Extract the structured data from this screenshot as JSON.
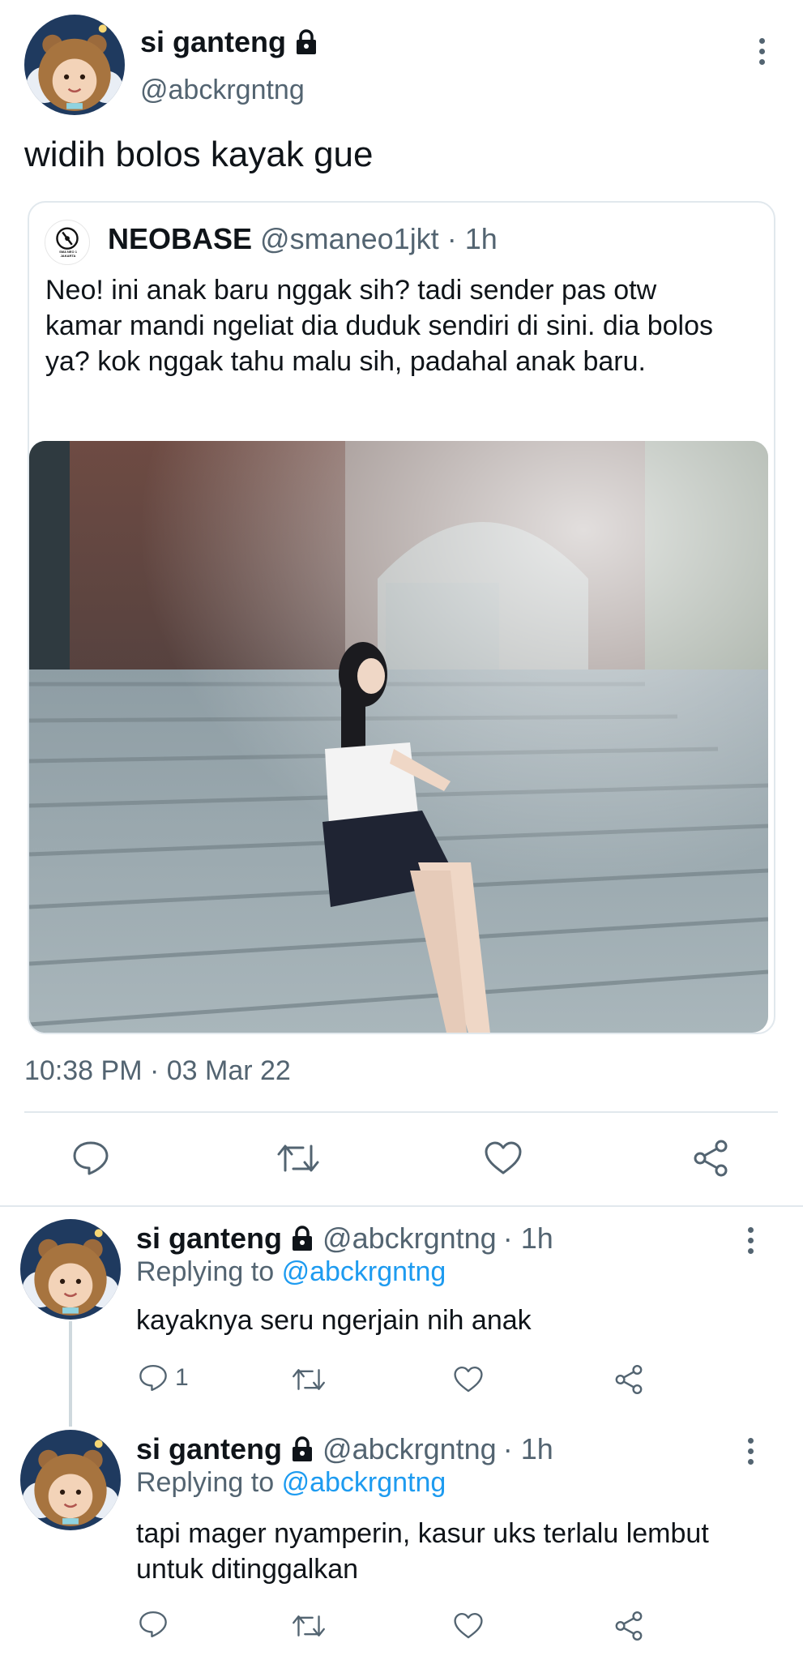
{
  "main_tweet": {
    "display_name": "si ganteng",
    "handle": "@abckrgntng",
    "text": "widih bolos kayak gue",
    "timestamp": "10:38 PM · 03 Mar 22"
  },
  "quoted_tweet": {
    "display_name": "NEOBASE",
    "handle": "@smaneo1jkt",
    "time": "· 1h",
    "avatar_text_1": "SMA NEO 1",
    "avatar_text_2": "JAKARTA",
    "text": "Neo! ini anak baru nggak sih? tadi sender pas otw kamar mandi ngeliat dia duduk sendiri di sini. dia bolos ya? kok nggak tahu malu sih, padahal anak baru."
  },
  "replies": [
    {
      "display_name": "si ganteng",
      "handle": "@abckrgntng",
      "time": "· 1h",
      "replying_prefix": "Replying to",
      "replying_to": "@abckrgntng",
      "text": "kayaknya seru ngerjain nih anak",
      "reply_count": "1"
    },
    {
      "display_name": "si ganteng",
      "handle": "@abckrgntng",
      "time": "· 1h",
      "replying_prefix": "Replying to",
      "replying_to": "@abckrgntng",
      "text": "tapi mager nyamperin, kasur uks terlalu lembut untuk ditinggalkan",
      "reply_count": ""
    }
  ],
  "icons": {
    "reply": "speech-bubble-icon",
    "retweet": "retweet-icon",
    "like": "heart-icon",
    "share": "share-icon",
    "lock": "lock-icon",
    "more": "three-dots-vertical-icon"
  },
  "colors": {
    "text": "#0f1419",
    "muted": "#536471",
    "link": "#1d9bf0",
    "divider": "#cfd9de"
  }
}
